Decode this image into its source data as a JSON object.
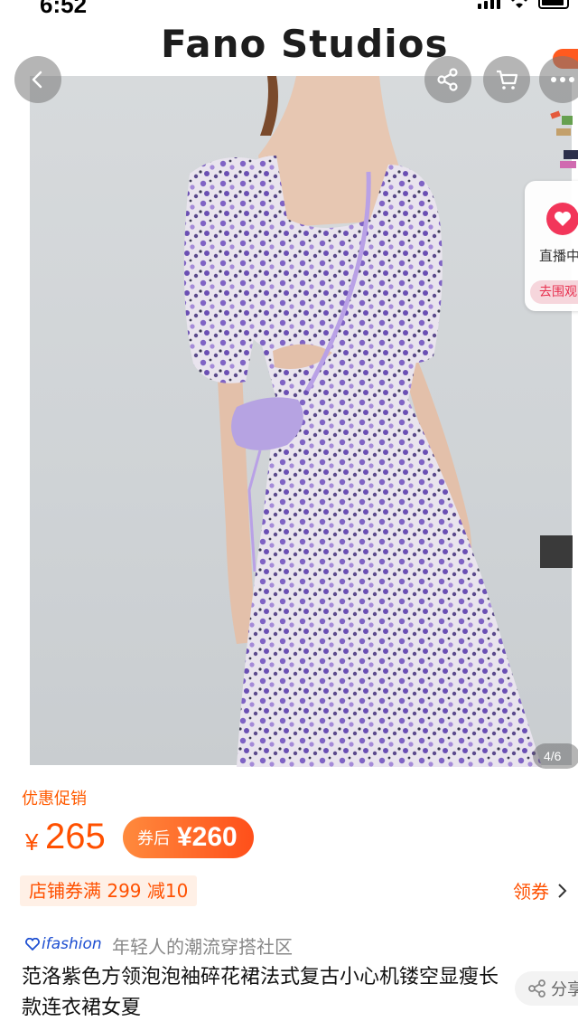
{
  "status_bar": {
    "time": "6:52"
  },
  "product_image": {
    "brand": "Fano Studios",
    "page_indicator": "4/6"
  },
  "live_widget": {
    "label": "直播中",
    "cta": "去围观"
  },
  "price": {
    "promo_label": "优惠促销",
    "currency": "¥",
    "value": "265",
    "coupon_prefix": "券后",
    "coupon_price": "¥260"
  },
  "coupon": {
    "store_coupon": "店铺券满 299 减10",
    "claim_label": "领券"
  },
  "brand_row": {
    "logo_text": "ifashion",
    "tagline": "年轻人的潮流穿搭社区"
  },
  "product": {
    "title": "范洛紫色方领泡泡袖碎花裙法式复古小心机镂空显瘦长款连衣裙女夏"
  },
  "share": {
    "label": "分享"
  },
  "colors": {
    "accent": "#ff5000",
    "live_pink": "#f2365a",
    "dress_purple": "#8a6bc9"
  }
}
